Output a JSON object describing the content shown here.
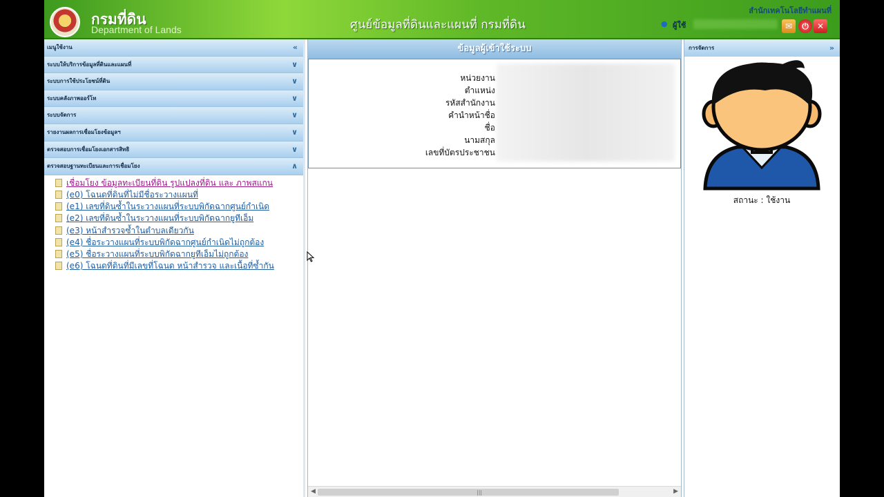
{
  "header": {
    "brand_th": "กรมที่ดิน",
    "brand_en": "Department of Lands",
    "system_title": "ศูนย์ข้อมูลที่ดินและแผนที่ กรมที่ดิน",
    "org_name": "สำนักเทคโนโลยีทำแผนที่",
    "user_label": "ผู้ใช้"
  },
  "sidebar": {
    "menu_title": "เมนูใช้งาน",
    "sections": [
      {
        "label": "ระบบให้บริการข้อมูลที่ดินและแผนที่"
      },
      {
        "label": "ระบบการใช้ประโยชน์ที่ดิน"
      },
      {
        "label": "ระบบคลังภาพออร์โท"
      },
      {
        "label": "ระบบจัดการ"
      },
      {
        "label": "รายงานผลการเชื่อมโยงข้อมูลฯ"
      },
      {
        "label": "ตรวจสอบการเชื่อมโยงเอกสารสิทธิ"
      },
      {
        "label": "ตรวจสอบฐานทะเบียนและการเชื่อมโยง"
      }
    ],
    "links": [
      "เชื่อมโยง ข้อมูลทะเบียนที่ดิน รูปแปลงที่ดิน และ ภาพสแกน",
      "(e0) โฉนดที่ดินที่ไม่มีชื่อระวางแผนที่",
      "(e1) เลขที่ดินซ้ำในระวางแผนที่ระบบพิกัดฉากศูนย์กำเนิด",
      "(e2) เลขที่ดินซ้ำในระวางแผนที่ระบบพิกัดฉากยูทีเอ็ม",
      "(e3) หน้าสำรวจซ้ำในตำบลเดียวกัน",
      "(e4) ชื่อระวางแผนที่ระบบพิกัดฉากศูนย์กำเนิดไม่ถูกต้อง",
      "(e5) ชื่อระวางแผนที่ระบบพิกัดฉากยูทีเอ็มไม่ถูกต้อง",
      "(e6) โฉนดที่ดินที่มีเลขที่โฉนด หน้าสำรวจ และเนื้อที่ซ้ำกัน"
    ]
  },
  "center": {
    "title": "ข้อมูลผู้เข้าใช้ระบบ",
    "fields": [
      "หน่วยงาน",
      "ตำแหน่ง",
      "รหัสสำนักงาน",
      "คำนำหน้าชื่อ",
      "ชื่อ",
      "นามสกุล",
      "เลขที่บัตรประชาชน"
    ]
  },
  "right": {
    "title": "การจัดการ",
    "status_label": "สถานะ :",
    "status_value": "ใช้งาน"
  },
  "icons": {
    "collapse": "double-chevron-left",
    "expand": "double-chevron-down",
    "collapse_up": "double-chevron-up",
    "right_toggle": "double-chevron-right"
  },
  "colors": {
    "header_green": "#5fb827",
    "accordion_blue": "#a9cfee",
    "link_blue": "#1d5ea3",
    "link_active": "#9b1a8a"
  }
}
